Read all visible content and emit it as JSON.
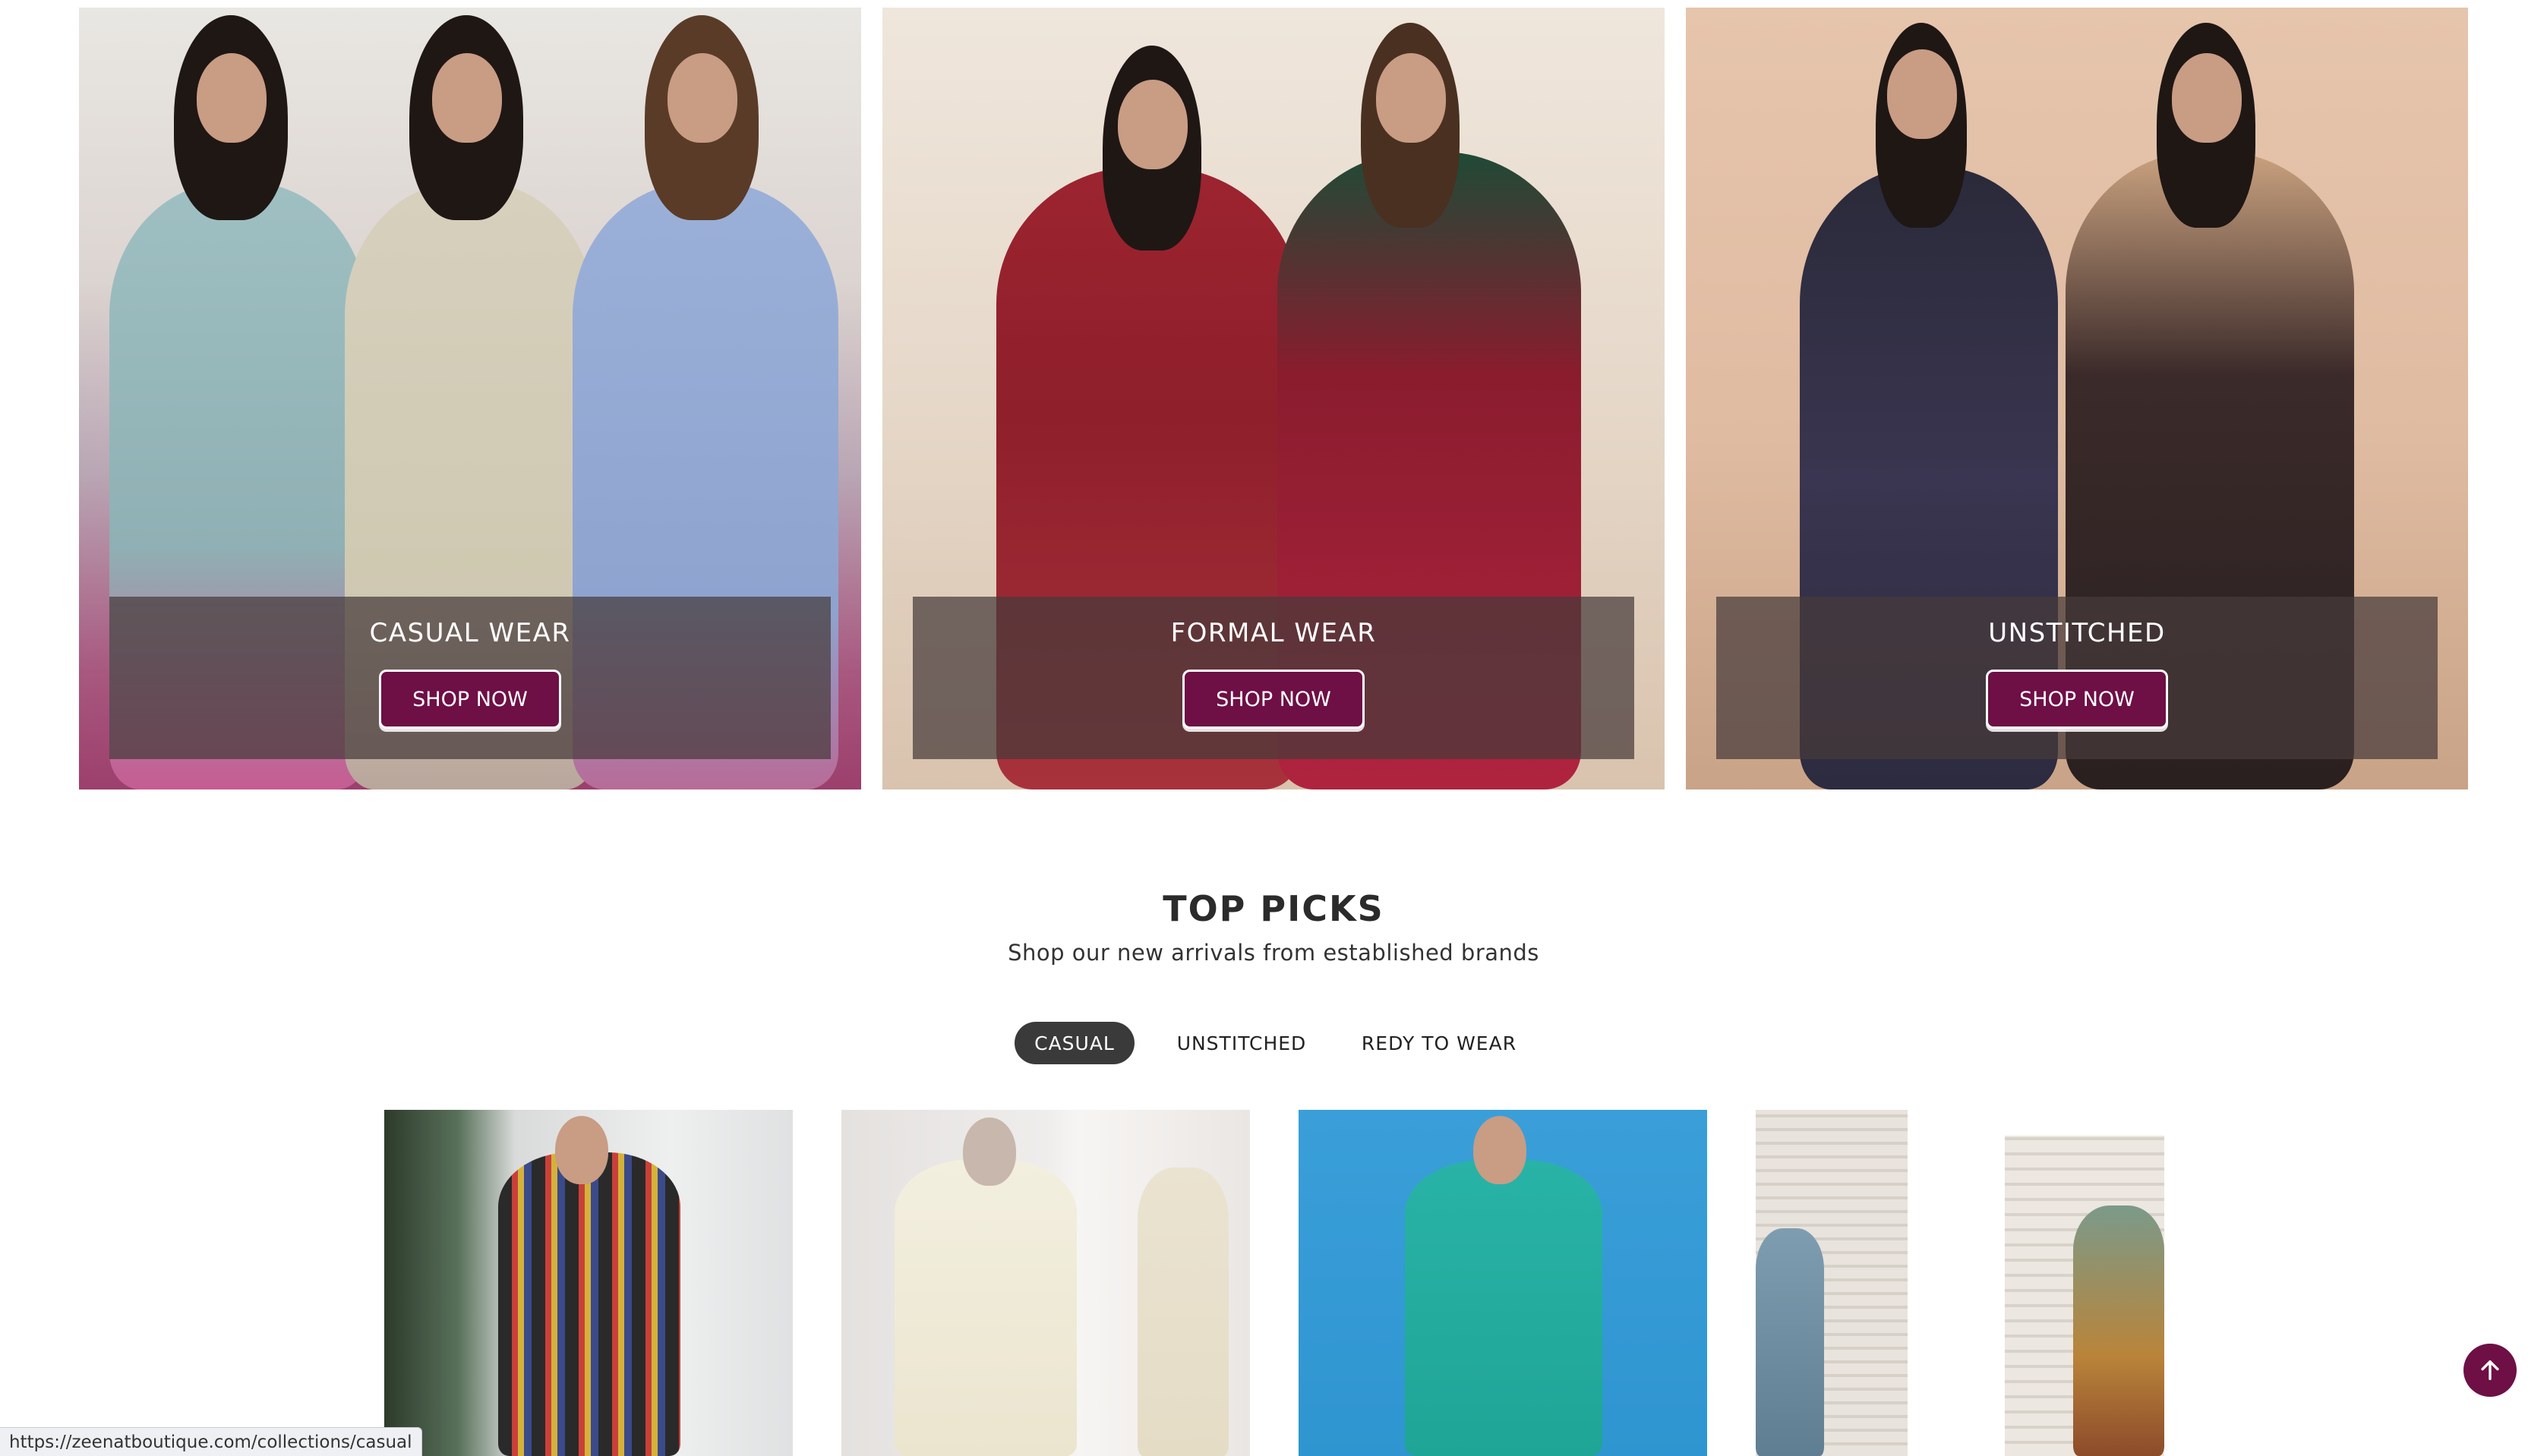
{
  "banners": [
    {
      "title": "CASUAL WEAR",
      "button": "SHOP NOW"
    },
    {
      "title": "FORMAL WEAR",
      "button": "SHOP NOW"
    },
    {
      "title": "UNSTITCHED",
      "button": "SHOP NOW"
    }
  ],
  "top_picks": {
    "title": "TOP PICKS",
    "subtitle": "Shop our new arrivals from established brands",
    "tabs": [
      {
        "label": "CASUAL",
        "active": true
      },
      {
        "label": "UNSTITCHED",
        "active": false
      },
      {
        "label": "REDY TO WEAR",
        "active": false
      }
    ]
  },
  "status_bar": {
    "url": "https://zeenatboutique.com/collections/casual"
  },
  "colors": {
    "brand": "#6e0f45",
    "tab_active": "#3a3a3a",
    "overlay": "#463a3a"
  },
  "icons": {
    "scroll_top": "arrow-up-icon"
  }
}
